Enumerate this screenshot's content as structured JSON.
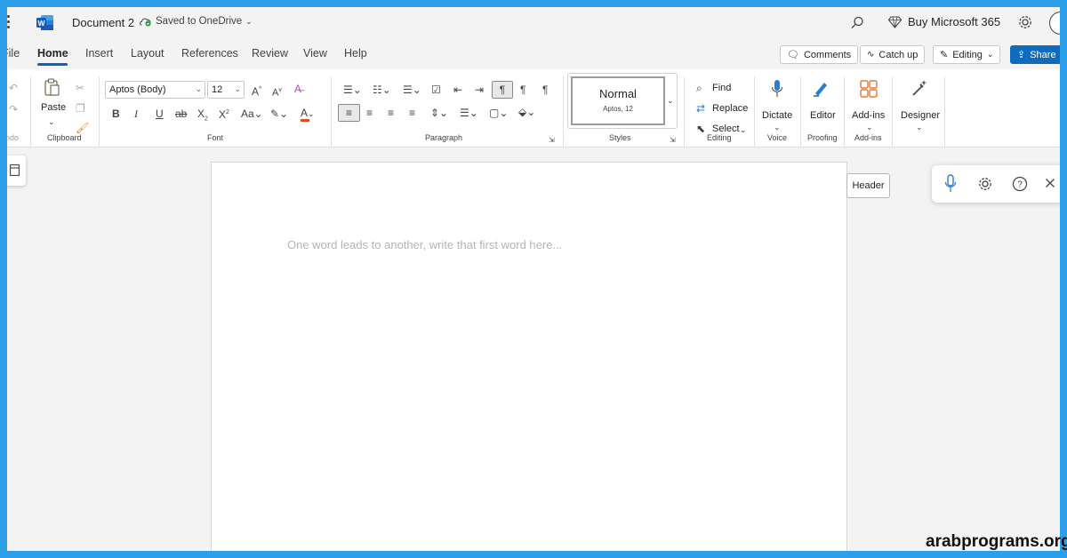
{
  "titlebar": {
    "doc_name": "Document 2",
    "save_status": "Saved to OneDrive",
    "buy_label": "Buy Microsoft 365"
  },
  "tabs": [
    "File",
    "Home",
    "Insert",
    "Layout",
    "References",
    "Review",
    "View",
    "Help"
  ],
  "active_tab": "Home",
  "header_buttons": {
    "comments": "Comments",
    "catch_up": "Catch up",
    "editing": "Editing",
    "share": "Share"
  },
  "ribbon": {
    "undo_label": "ndo",
    "clipboard": {
      "paste": "Paste",
      "label": "Clipboard"
    },
    "font": {
      "name": "Aptos (Body)",
      "size": "12",
      "label": "Font"
    },
    "paragraph": {
      "label": "Paragraph"
    },
    "styles": {
      "current": "Normal",
      "detail": "Aptos, 12",
      "label": "Styles"
    },
    "editing": {
      "find": "Find",
      "replace": "Replace",
      "select": "Select",
      "label": "Editing"
    },
    "voice": {
      "dictate": "Dictate",
      "label": "Voice"
    },
    "proofing": {
      "editor": "Editor",
      "label": "Proofing"
    },
    "addins": {
      "button": "Add-ins",
      "label": "Add-ins"
    },
    "designer": {
      "button": "Designer"
    }
  },
  "document": {
    "placeholder": "One word leads to another, write that first word here..."
  },
  "header_tooltip": "Header",
  "watermark": "arabprograms.org",
  "colors": {
    "accent": "#185abd",
    "share_bg": "#0f6cbd",
    "font_color_bar": "#e04b1a"
  }
}
